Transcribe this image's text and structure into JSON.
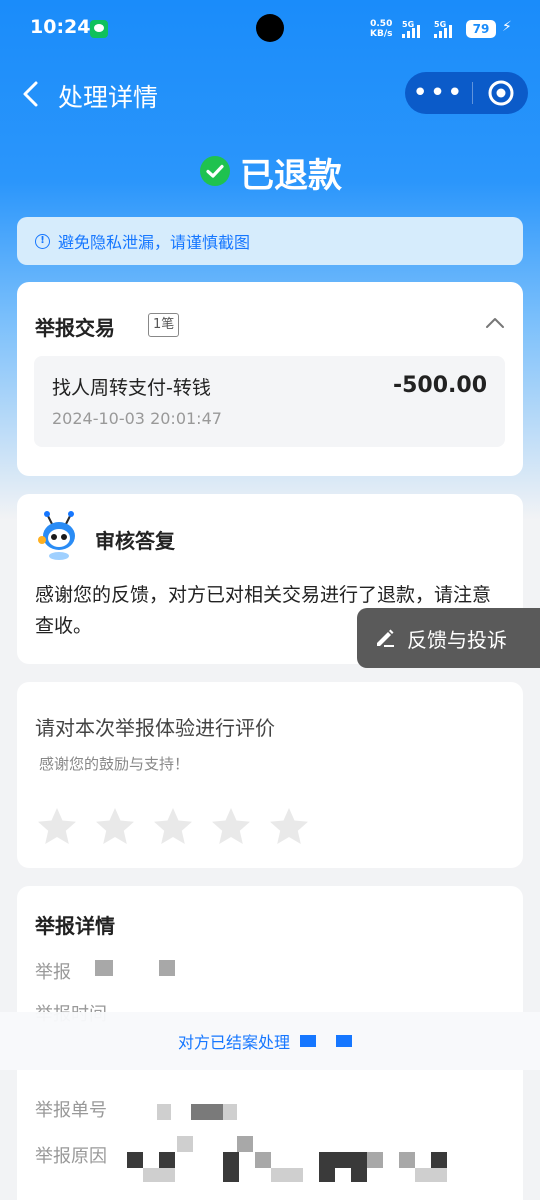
{
  "status_bar": {
    "time": "10:24",
    "net_speed_value": "0.50",
    "net_speed_unit": "KB/s",
    "signal_1": "5G",
    "signal_2": "5G",
    "battery": "79"
  },
  "nav": {
    "title": "处理详情",
    "more": "•••"
  },
  "status": {
    "text": "已退款",
    "color": "#1fc24f"
  },
  "notice": {
    "text": "避免隐私泄漏，请谨慎截图"
  },
  "report_transactions": {
    "title": "举报交易",
    "count": "1笔",
    "items": [
      {
        "name": "找人周转支付-转钱",
        "amount": "-500.00",
        "time": "2024-10-03 20:01:47"
      }
    ]
  },
  "review_reply": {
    "title": "审核答复",
    "body": "感谢您的反馈，对方已对相关交易进行了退款，请注意查收。"
  },
  "floating_button": {
    "label": "反馈与投诉"
  },
  "rating": {
    "title": "请对本次举报体验进行评价",
    "subtitle": "感谢您的鼓励与支持！",
    "max_stars": 5,
    "selected": 0
  },
  "report_details": {
    "title": "举报详情",
    "fields": [
      {
        "label": "举报时间"
      },
      {
        "label": "举报单号"
      },
      {
        "label": "举报原因"
      }
    ],
    "banner_text": "对方已结案处理"
  },
  "colors": {
    "primary": "#1677ff",
    "header_bg": "#1a8cfa",
    "capsule_bg": "#0b5bc9"
  }
}
